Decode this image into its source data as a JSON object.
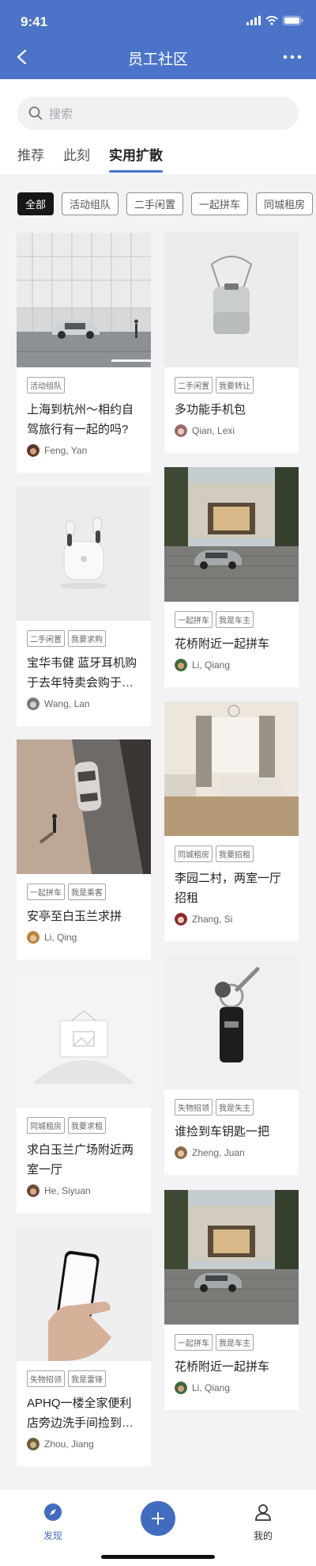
{
  "status": {
    "time": "9:41"
  },
  "header": {
    "title": "员工社区"
  },
  "search": {
    "placeholder": "搜索"
  },
  "tabs": [
    {
      "label": "推荐"
    },
    {
      "label": "此刻"
    },
    {
      "label": "实用扩散",
      "active": true
    }
  ],
  "chips": [
    {
      "label": "全部",
      "active": true
    },
    {
      "label": "活动组队"
    },
    {
      "label": "二手闲置"
    },
    {
      "label": "一起拼车"
    },
    {
      "label": "同城租房"
    }
  ],
  "left_cards": [
    {
      "tags": [
        "活动组队"
      ],
      "title": "上海到杭州～相约自驾旅行有一起的吗?",
      "author": "Feng, Yan",
      "image": "car-building"
    },
    {
      "tags": [
        "二手闲置",
        "我要求购"
      ],
      "title": "宝华韦健 蓝牙耳机购于去年特卖会购于…",
      "author": "Wang, Lan",
      "image": "earbuds"
    },
    {
      "tags": [
        "一起拼车",
        "我是乘客"
      ],
      "title": "安亭至白玉兰求拼",
      "author": "Li, Qing",
      "image": "car-road"
    },
    {
      "tags": [
        "同城租房",
        "我要求租"
      ],
      "title": "求白玉兰广场附近两室一厅",
      "author": "He, Siyuan",
      "image": "placeholder"
    },
    {
      "tags": [
        "失物招领",
        "我是雷锋"
      ],
      "title": "APHQ一楼全家便利店旁边洗手间捡到…",
      "author": "Zhou, Jiang",
      "image": "phone"
    }
  ],
  "right_cards": [
    {
      "tags": [
        "二手闲置",
        "我要转让"
      ],
      "title": "多功能手机包",
      "author": "Qian, Lexi",
      "image": "phone-bag"
    },
    {
      "tags": [
        "一起拼车",
        "我是车主"
      ],
      "title": "花桥附近一起拼车",
      "author": "Li, Qiang",
      "image": "building-car"
    },
    {
      "tags": [
        "同城租房",
        "我要招租"
      ],
      "title": "李园二村，两室一厅招租",
      "author": "Zhang, Si",
      "image": "living-room"
    },
    {
      "tags": [
        "失物招领",
        "我是失主"
      ],
      "title": "谁捡到车钥匙一把",
      "author": "Zheng, Juan",
      "image": "car-key"
    },
    {
      "tags": [
        "一起拼车",
        "我是车主"
      ],
      "title": "花桥附近一起拼车",
      "author": "Li, Qiang",
      "image": "building-car"
    }
  ],
  "bottom_nav": {
    "discover": "发现",
    "mine": "我的"
  },
  "colors": {
    "primary": "#4b74c8",
    "fab": "#3f6cbf",
    "chip_active": "#171717"
  }
}
